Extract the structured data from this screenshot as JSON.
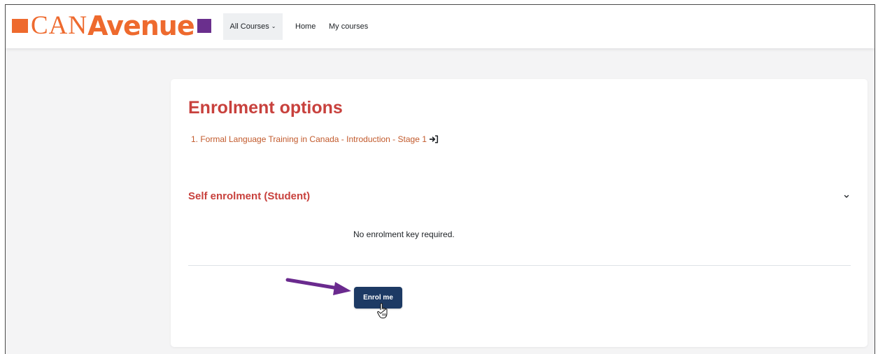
{
  "navbar": {
    "logo": {
      "can": "CAN",
      "avenue": "Avenue"
    },
    "items": [
      {
        "label": "All Courses",
        "dropdown": true
      },
      {
        "label": "Home"
      },
      {
        "label": "My courses"
      }
    ]
  },
  "page": {
    "title": "Enrolment options",
    "course_link": "1. Formal Language Training in Canada - Introduction - Stage 1",
    "section_title": "Self enrolment (Student)",
    "info_text": "No enrolment key required.",
    "enrol_button": "Enrol me"
  },
  "colors": {
    "brand_orange": "#ee6a2e",
    "brand_purple": "#6a2f8d",
    "heading_red": "#c8413d",
    "button_navy": "#1d3a64",
    "arrow_purple": "#6a2a8e"
  },
  "icons": {
    "course_enter": "sign-in-icon",
    "section_toggle": "chevron-down-icon",
    "annotation": "arrow-right-icon",
    "pointer": "hand-cursor-icon"
  }
}
